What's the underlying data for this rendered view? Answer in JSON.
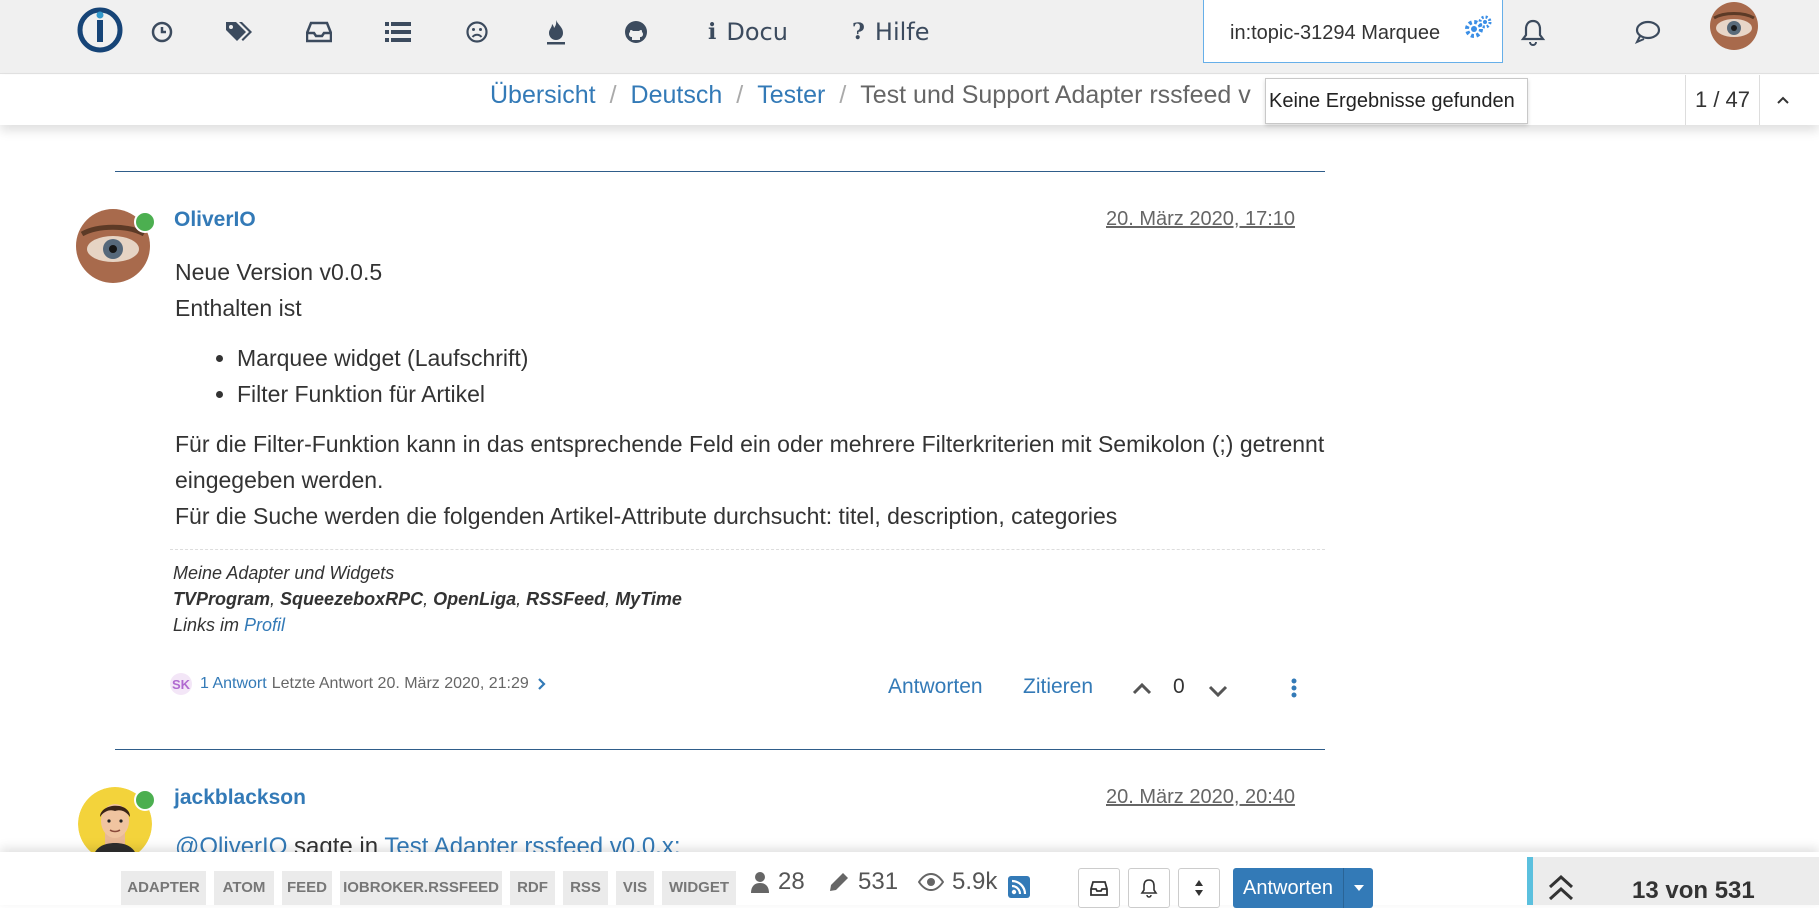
{
  "nav": {
    "docu_label": "Docu",
    "hilfe_label": "Hilfe",
    "docu_glyph": "i",
    "hilfe_glyph": "?",
    "icons": [
      "clock-icon",
      "tags-icon",
      "inbox-icon",
      "list-icon",
      "frown-icon",
      "fire-icon",
      "github-icon",
      "bell-icon",
      "chat-icon"
    ]
  },
  "search": {
    "value": "in:topic-31294 Marquee",
    "no_results": "Keine Ergebnisse gefunden"
  },
  "breadcrumb": {
    "items": [
      "Übersicht",
      "Deutsch",
      "Tester"
    ],
    "current": "Test und Support Adapter rssfeed v",
    "separator": "/"
  },
  "pager": {
    "position": "1 / 47"
  },
  "post1": {
    "author": "OliverIO",
    "date": "20. März 2020, 17:10",
    "line1": "Neue Version v0.0.5",
    "line2": "Enthalten ist",
    "bullets": [
      "Marquee widget (Laufschrift)",
      "Filter Funktion für Artikel"
    ],
    "para1": "Für die Filter-Funktion kann in das entsprechende Feld ein oder mehrere Filterkriterien mit Semikolon (;) getrennt eingegeben werden.",
    "para2": "Für die Suche werden die folgenden Artikel-Attribute durchsucht: titel, description, categories",
    "signature": {
      "line1": "Meine Adapter und Widgets",
      "adapters": [
        "TVProgram",
        "SqueezeboxRPC",
        "OpenLiga",
        "RSSFeed",
        "MyTime"
      ],
      "links_prefix": "Links im",
      "profile_link": "Profil"
    },
    "replies": {
      "avatar_initials": "SK",
      "count": "1 Antwort",
      "last": "Letzte Antwort 20. März 2020, 21:29"
    },
    "actions": {
      "reply": "Antworten",
      "quote": "Zitieren"
    },
    "votes": "0"
  },
  "post2": {
    "author": "jackblackson",
    "date": "20. März 2020, 20:40",
    "quote_user": "@OliverIO",
    "quote_said": "sagte in",
    "quote_topic": "Test Adapter rssfeed v0.0.x:"
  },
  "bottom": {
    "tags": [
      "ADAPTER",
      "ATOM",
      "FEED",
      "IOBROKER.RSSFEED",
      "RDF",
      "RSS",
      "VIS",
      "WIDGET"
    ],
    "posters": "28",
    "posts": "531",
    "views": "5.9k",
    "reply_button": "Antworten",
    "progress": "13 von 531"
  },
  "colors": {
    "accent": "#337ab7",
    "online": "#4caf50",
    "topbar": "#f0f0f0",
    "progress_bar": "#5bc0de"
  }
}
